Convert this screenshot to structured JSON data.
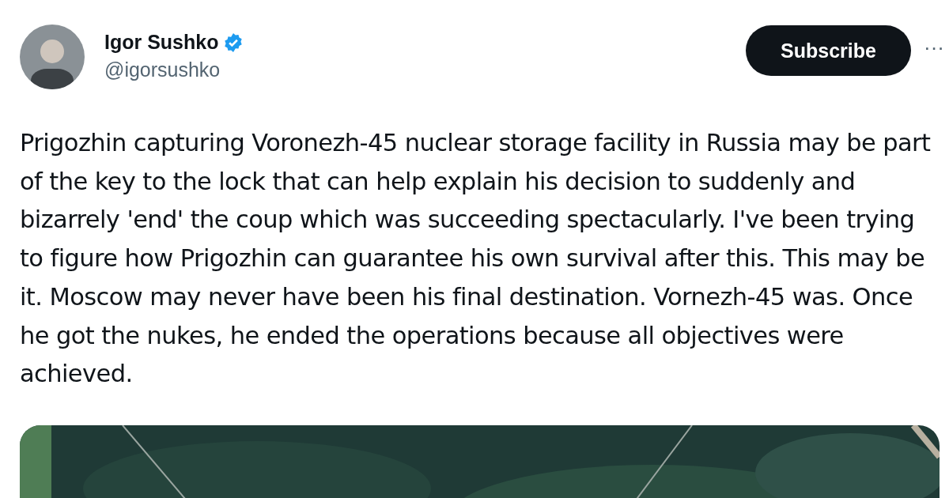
{
  "author": {
    "name": "Igor Sushko",
    "verified": true,
    "handle": "@igorsushko"
  },
  "subscribe_button": "Subscribe",
  "more_button": "···",
  "text": "Prigozhin capturing Voronezh-45 nuclear storage facility in Russia may be part of the key to the lock that can help explain his decision to suddenly and bizarrely 'end' the coup which was succeeding spectacularly. I've been trying to figure how Prigozhin can guarantee his own survival after this. This may be it. Moscow may never have been his final destination. Vornezh-45 was. Once he got the nukes, he ended the operations because all objectives were achieved."
}
